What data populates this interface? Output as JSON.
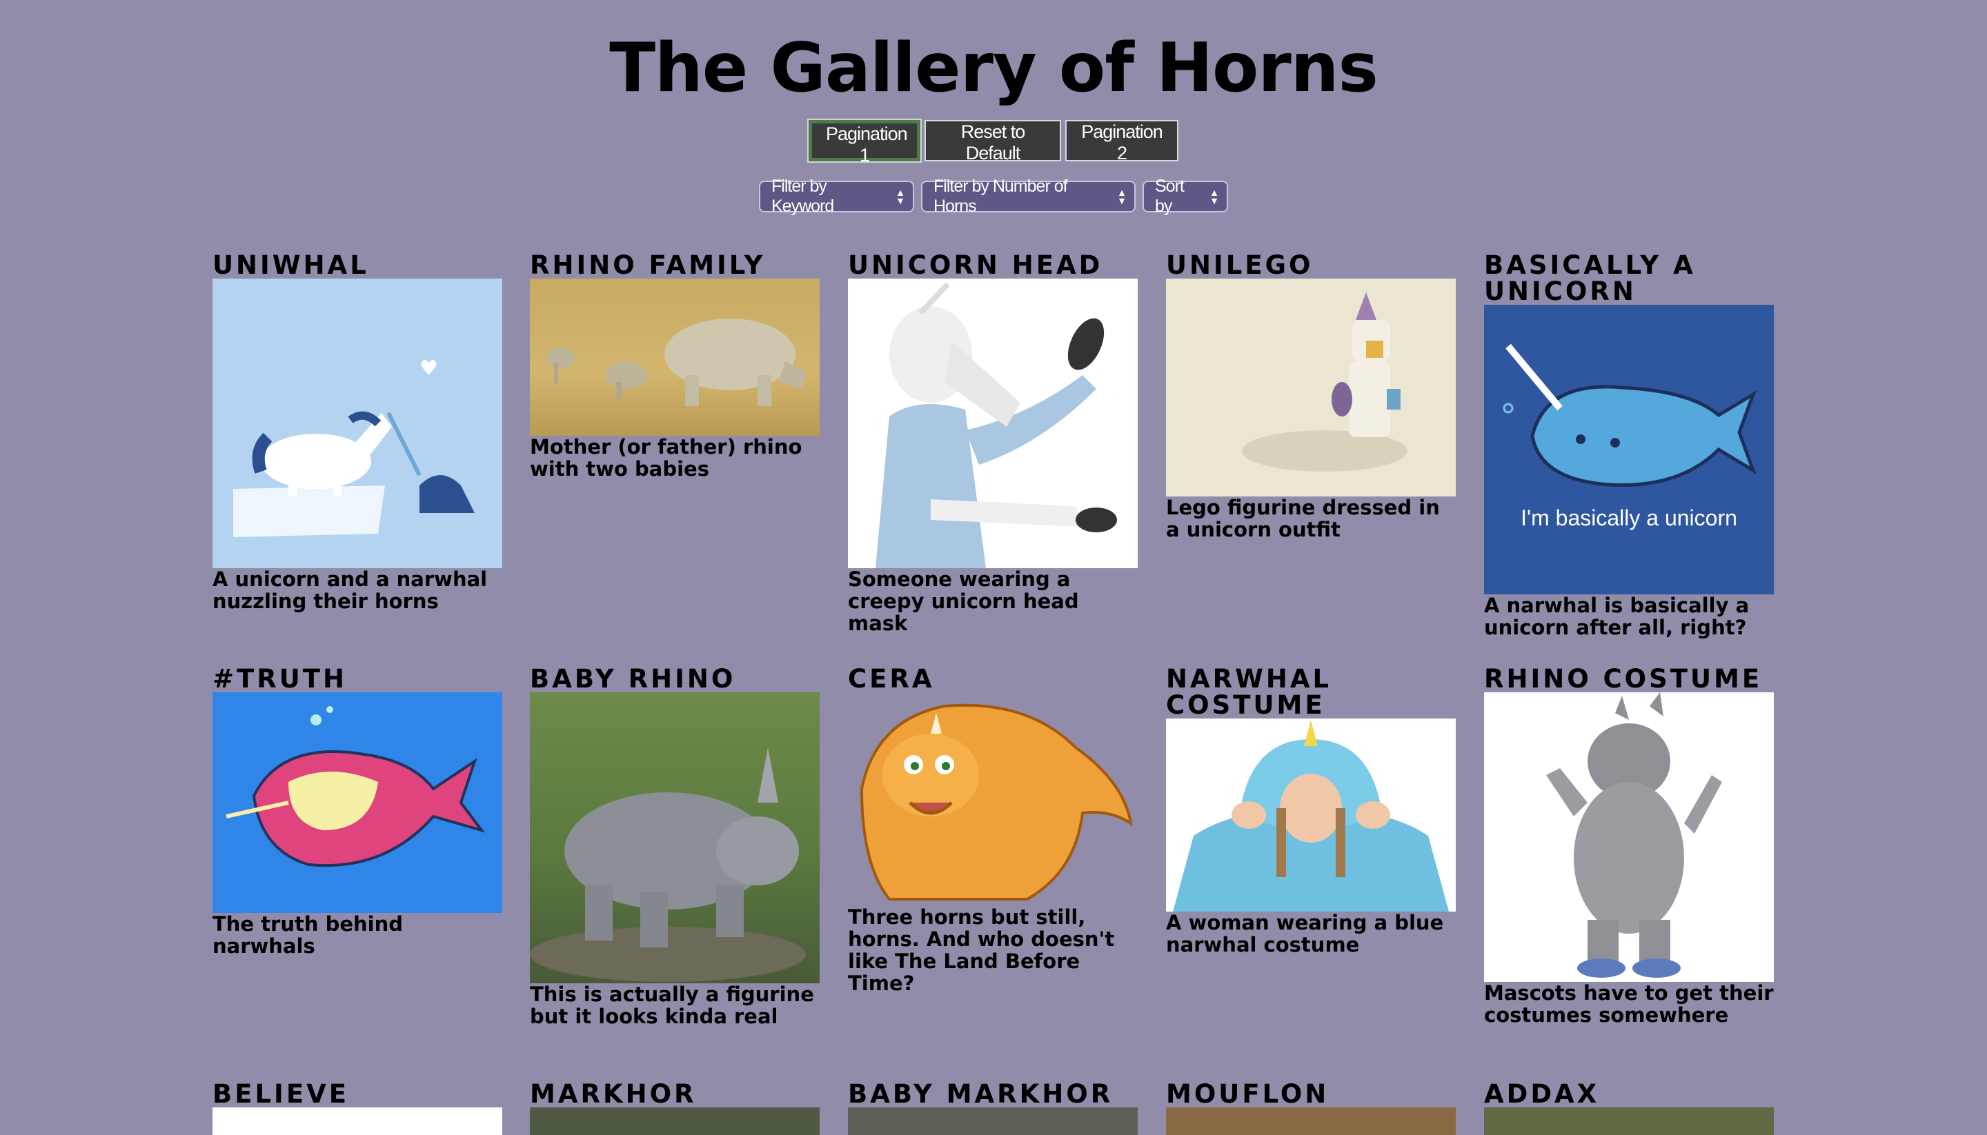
{
  "page": {
    "title": "The Gallery of Horns"
  },
  "buttons": {
    "pagination1": "Pagination 1",
    "reset": "Reset to Default",
    "pagination2": "Pagination 2"
  },
  "filters": {
    "keyword": "Filter by Keyword",
    "horns": "Filter by Number of Horns",
    "sort": "Sort by"
  },
  "cards": [
    {
      "title": "UniWhal",
      "desc": "A unicorn and a narwhal nuzzling their horns"
    },
    {
      "title": "Rhino Family",
      "desc": "Mother (or father) rhino with two babies"
    },
    {
      "title": "Unicorn Head",
      "desc": "Someone wearing a creepy unicorn head mask"
    },
    {
      "title": "UniLego",
      "desc": "Lego figurine dressed in a unicorn outfit"
    },
    {
      "title": "Basically a unicorn",
      "desc": "A narwhal is basically a unicorn after all, right?",
      "img_text": "I'm basically a unicorn"
    },
    {
      "title": "#truth",
      "desc": "The truth behind narwhals"
    },
    {
      "title": "Baby Rhino",
      "desc": "This is actually a figurine but it looks kinda real"
    },
    {
      "title": "Cera",
      "desc": "Three horns but still, horns. And who doesn't like The Land Before Time?"
    },
    {
      "title": "Narwhal Costume",
      "desc": "A woman wearing a blue narwhal costume"
    },
    {
      "title": "Rhino Costume",
      "desc": "Mascots have to get their costumes somewhere"
    },
    {
      "title": "Believe",
      "desc": ""
    },
    {
      "title": "Markhor",
      "desc": ""
    },
    {
      "title": "Baby Markhor",
      "desc": ""
    },
    {
      "title": "Mouflon",
      "desc": ""
    },
    {
      "title": "Addax",
      "desc": ""
    }
  ],
  "colors": {
    "background": "#918ca9",
    "button": "#3a3a3a",
    "select": "#5f5786"
  }
}
